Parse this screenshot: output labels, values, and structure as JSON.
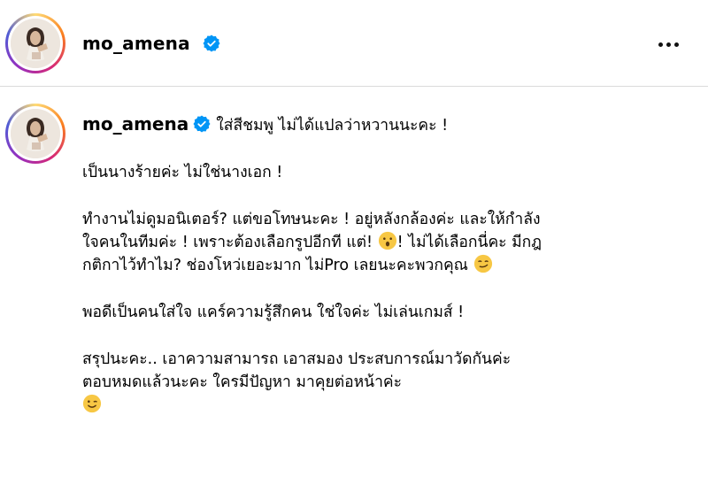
{
  "header": {
    "username": "mo_amena",
    "verified": true,
    "avatar_icon": "profile-photo",
    "more_icon": "more-options-icon"
  },
  "post": {
    "username": "mo_amena",
    "verified": true,
    "caption_lines": [
      "ใส่สีชมพู ไม่ได้แปลว่าหวานนะคะ !",
      "เป็นนางร้ายค่ะ ไม่ใช่นางเอก !",
      "ทำงานไม่ดูมอนิเตอร์? แต่ขอโทษนะคะ ! อยู่หลังกล้องค่ะ และให้กำลัง",
      "ใจคนในทีมค่ะ ! เพราะต้องเลือกรูปอีกที แต่!",
      "! ไม่ได้เลือกนี่คะ มีกฎ",
      "กติกาไว้ทำไม? ช่องโหว่เยอะมาก ไม่Pro เลยนะคะพวกคุณ",
      "พอดีเป็นคนใส่ใจ แคร์ความรู้สึกคน ใช่ใจค่ะ ไม่เล่นเกมส์ !",
      "สรุปนะคะ.. เอาความสามารถ เอาสมอง ประสบการณ์มาวัดกันค่ะ",
      "ตอบหมดแล้วนะคะ ใครมีปัญหา มาคุยต่อหน้าค่ะ"
    ],
    "emojis": [
      "hushed-face-emoji",
      "smirking-face-emoji",
      "winking-face-emoji"
    ]
  },
  "colors": {
    "verified": "#0095f6",
    "divider": "#dbdbdb"
  }
}
